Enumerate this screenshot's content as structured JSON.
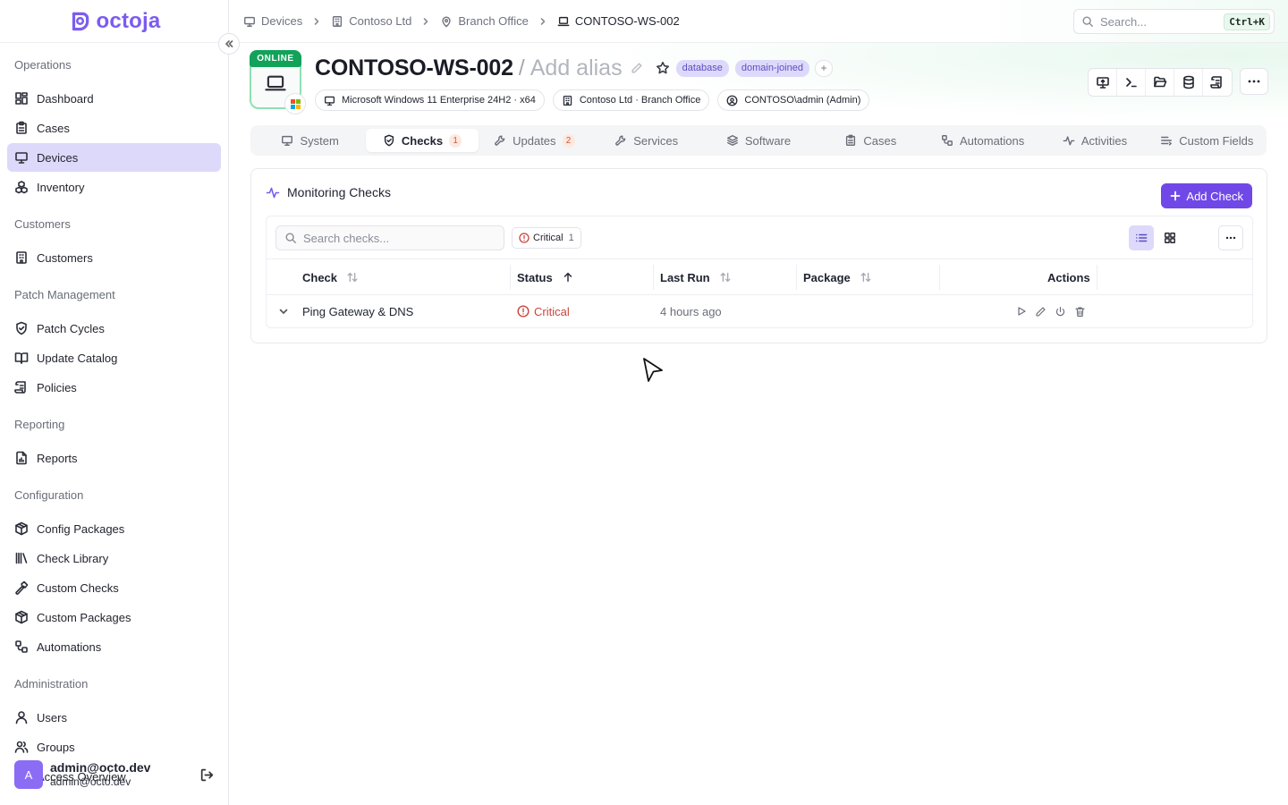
{
  "app": {
    "name": "octoja"
  },
  "sidebar": {
    "sections": [
      {
        "title": "Operations",
        "items": [
          "Dashboard",
          "Cases",
          "Devices",
          "Inventory"
        ]
      },
      {
        "title": "Customers",
        "items": [
          "Customers"
        ]
      },
      {
        "title": "Patch Management",
        "items": [
          "Patch Cycles",
          "Update Catalog",
          "Policies"
        ]
      },
      {
        "title": "Reporting",
        "items": [
          "Reports"
        ]
      },
      {
        "title": "Configuration",
        "items": [
          "Config Packages",
          "Check Library",
          "Custom Checks",
          "Custom Packages",
          "Automations"
        ]
      },
      {
        "title": "Administration",
        "items": [
          "Users",
          "Groups",
          "Access Overview"
        ]
      }
    ],
    "active_item": "Devices",
    "user": {
      "initial": "A",
      "name": "admin@octo.dev",
      "email": "admin@octo.dev"
    }
  },
  "breadcrumb": [
    "Devices",
    "Contoso Ltd",
    "Branch Office",
    "CONTOSO-WS-002"
  ],
  "search": {
    "placeholder": "Search...",
    "shortcut": "Ctrl+K"
  },
  "device": {
    "status": "ONLINE",
    "name": "CONTOSO-WS-002",
    "separator": "/",
    "alias_placeholder": "Add alias",
    "tags": [
      "database",
      "domain-joined"
    ],
    "tag_add": "+",
    "os": "Microsoft Windows 11 Enterprise 24H2 · x64",
    "location": "Contoso Ltd · Branch Office",
    "user": "CONTOSO\\admin (Admin)"
  },
  "tabs": [
    {
      "label": "System"
    },
    {
      "label": "Checks",
      "count": "1"
    },
    {
      "label": "Updates",
      "count": "2"
    },
    {
      "label": "Services"
    },
    {
      "label": "Software"
    },
    {
      "label": "Cases"
    },
    {
      "label": "Automations"
    },
    {
      "label": "Activities"
    },
    {
      "label": "Custom Fields"
    }
  ],
  "active_tab": "Checks",
  "checks": {
    "title": "Monitoring Checks",
    "add_button": "Add Check",
    "search_placeholder": "Search checks...",
    "filter": {
      "label": "Critical",
      "count": "1"
    },
    "columns": {
      "check": "Check",
      "status": "Status",
      "last_run": "Last Run",
      "package": "Package",
      "actions": "Actions"
    },
    "rows": [
      {
        "check": "Ping Gateway & DNS",
        "status": "Critical",
        "last_run": "4 hours ago",
        "package": ""
      }
    ]
  },
  "colors": {
    "accent": "#7048e8",
    "online": "#12a25a",
    "critical": "#c9463d",
    "tag_bg": "#ddd9fb"
  }
}
